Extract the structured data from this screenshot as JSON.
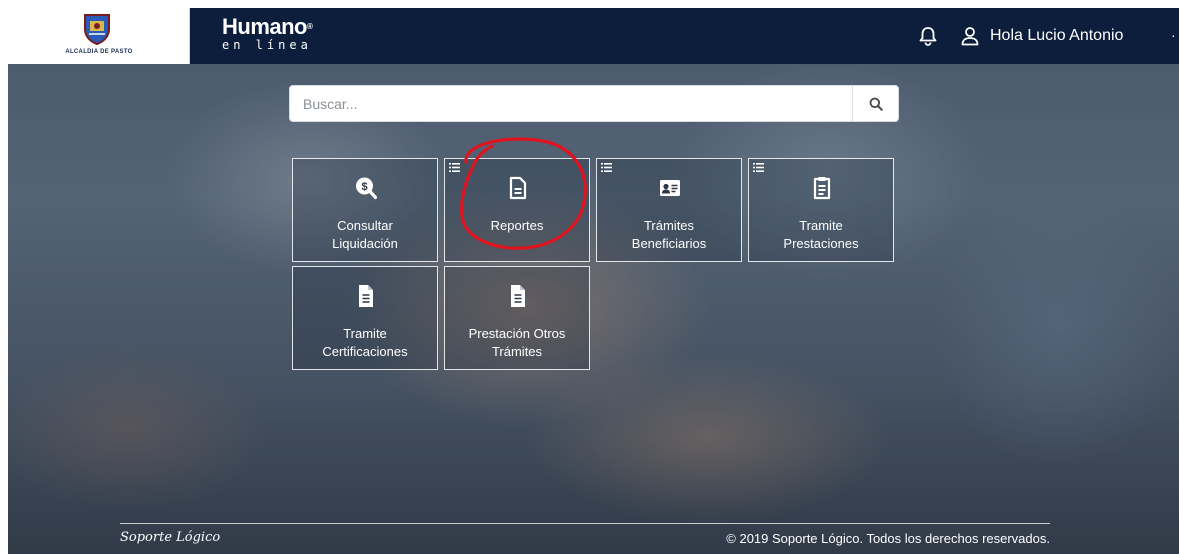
{
  "header": {
    "logo_caption": "ALCALDIA DE PASTO",
    "brand_name": "Humano",
    "brand_reg": "®",
    "brand_subtitle": "en línea",
    "greeting": "Hola Lucio Antonio",
    "caret": "·"
  },
  "search": {
    "placeholder": "Buscar...",
    "value": ""
  },
  "tiles": [
    {
      "label_line1": "Consultar",
      "label_line2": "Liquidación",
      "icon": "search-dollar-icon",
      "has_list_icon": false
    },
    {
      "label_line1": "Reportes",
      "label_line2": "",
      "icon": "document-icon",
      "has_list_icon": true
    },
    {
      "label_line1": "Trámites",
      "label_line2": "Beneficiarios",
      "icon": "id-card-icon",
      "has_list_icon": true
    },
    {
      "label_line1": "Tramite",
      "label_line2": "Prestaciones",
      "icon": "clipboard-document-icon",
      "has_list_icon": true
    },
    {
      "label_line1": "Tramite",
      "label_line2": "Certificaciones",
      "icon": "file-text-icon",
      "has_list_icon": false
    },
    {
      "label_line1": "Prestación Otros",
      "label_line2": "Trámites",
      "icon": "file-text-icon",
      "has_list_icon": false
    }
  ],
  "footer": {
    "logo_text": "Soporte Lógico",
    "copyright": "© 2019 Soporte Lógico. Todos los derechos reservados."
  },
  "colors": {
    "header_bg": "#0c1e3b",
    "annotation": "#e0141e"
  }
}
